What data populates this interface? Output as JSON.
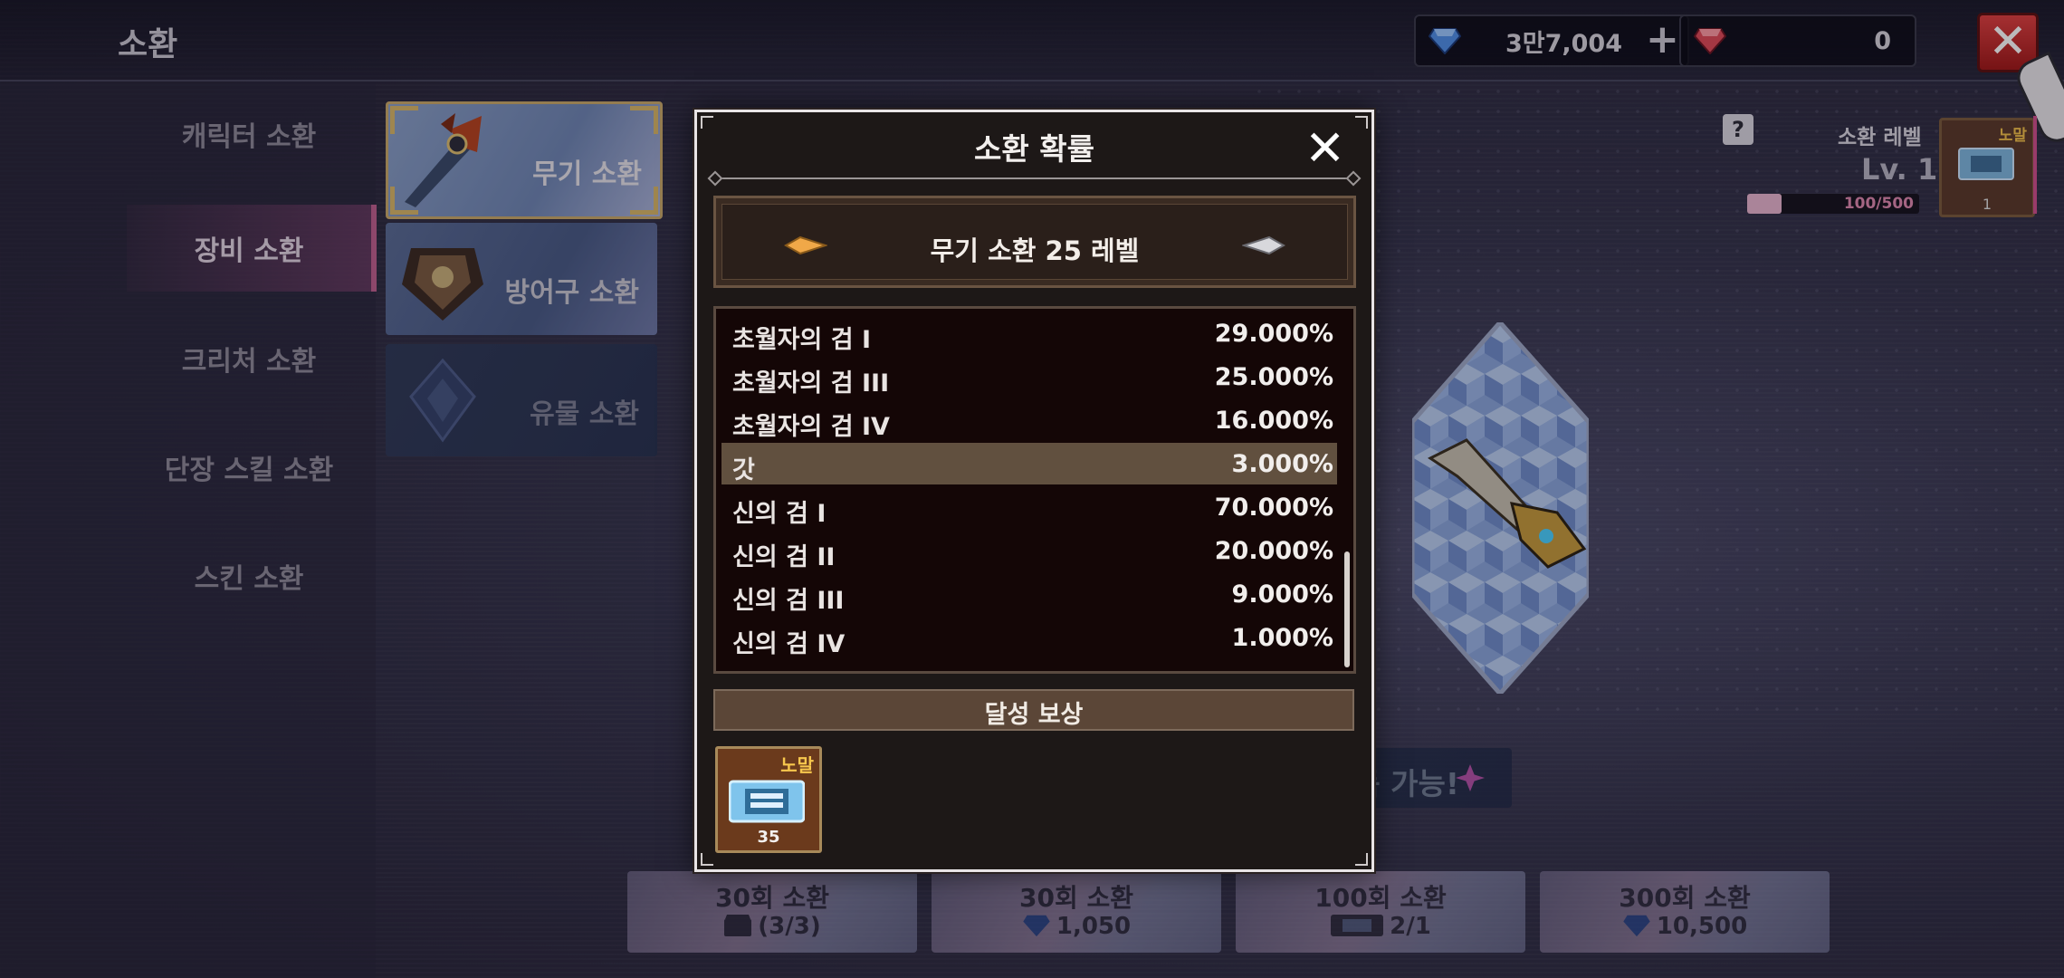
{
  "header": {
    "title": "소환",
    "blue_gems": "3만7,004",
    "red_gems": "0"
  },
  "sidebar": {
    "items": [
      {
        "label": "캐릭터 소환"
      },
      {
        "label": "장비 소환"
      },
      {
        "label": "크리처 소환"
      },
      {
        "label": "단장 스킬 소환"
      },
      {
        "label": "스킨 소환"
      }
    ]
  },
  "subtabs": [
    {
      "label": "무기 소환"
    },
    {
      "label": "방어구 소환"
    },
    {
      "label": "유물 소환"
    }
  ],
  "summon_level": {
    "label": "소환 레벨",
    "value": "Lv. 1",
    "progress_text": "100/500",
    "progress": 0.2,
    "card_grade": "노말",
    "card_count": "1"
  },
  "notice": "노말 ~ 갓 등급의 무기 획득 가능!",
  "summon_buttons": [
    {
      "title": "30회 소환",
      "cost": "(3/3)"
    },
    {
      "title": "30회 소환",
      "cost": "1,050"
    },
    {
      "title": "100회 소환",
      "cost": "2/1"
    },
    {
      "title": "300회 소환",
      "cost": "10,500"
    }
  ],
  "modal": {
    "title": "소환 확률",
    "level_title": "무기 소환 25 레벨",
    "probabilities": [
      {
        "name": "초월자의 검 I",
        "pct": "29.000%"
      },
      {
        "name": "초월자의 검 III",
        "pct": "25.000%"
      },
      {
        "name": "초월자의 검 IV",
        "pct": "16.000%"
      },
      {
        "name": "갓",
        "pct": "3.000%"
      },
      {
        "name": "신의 검 I",
        "pct": "70.000%"
      },
      {
        "name": "신의 검 II",
        "pct": "20.000%"
      },
      {
        "name": "신의 검 III",
        "pct": "9.000%"
      },
      {
        "name": "신의 검 IV",
        "pct": "1.000%"
      }
    ],
    "reward_title": "달성 보상",
    "reward_grade": "노말",
    "reward_count": "35"
  },
  "colors": {
    "accent_pink": "#c0608f",
    "gold": "#d9b869",
    "close_red": "#d03030",
    "highlight_row": "#61503f"
  }
}
